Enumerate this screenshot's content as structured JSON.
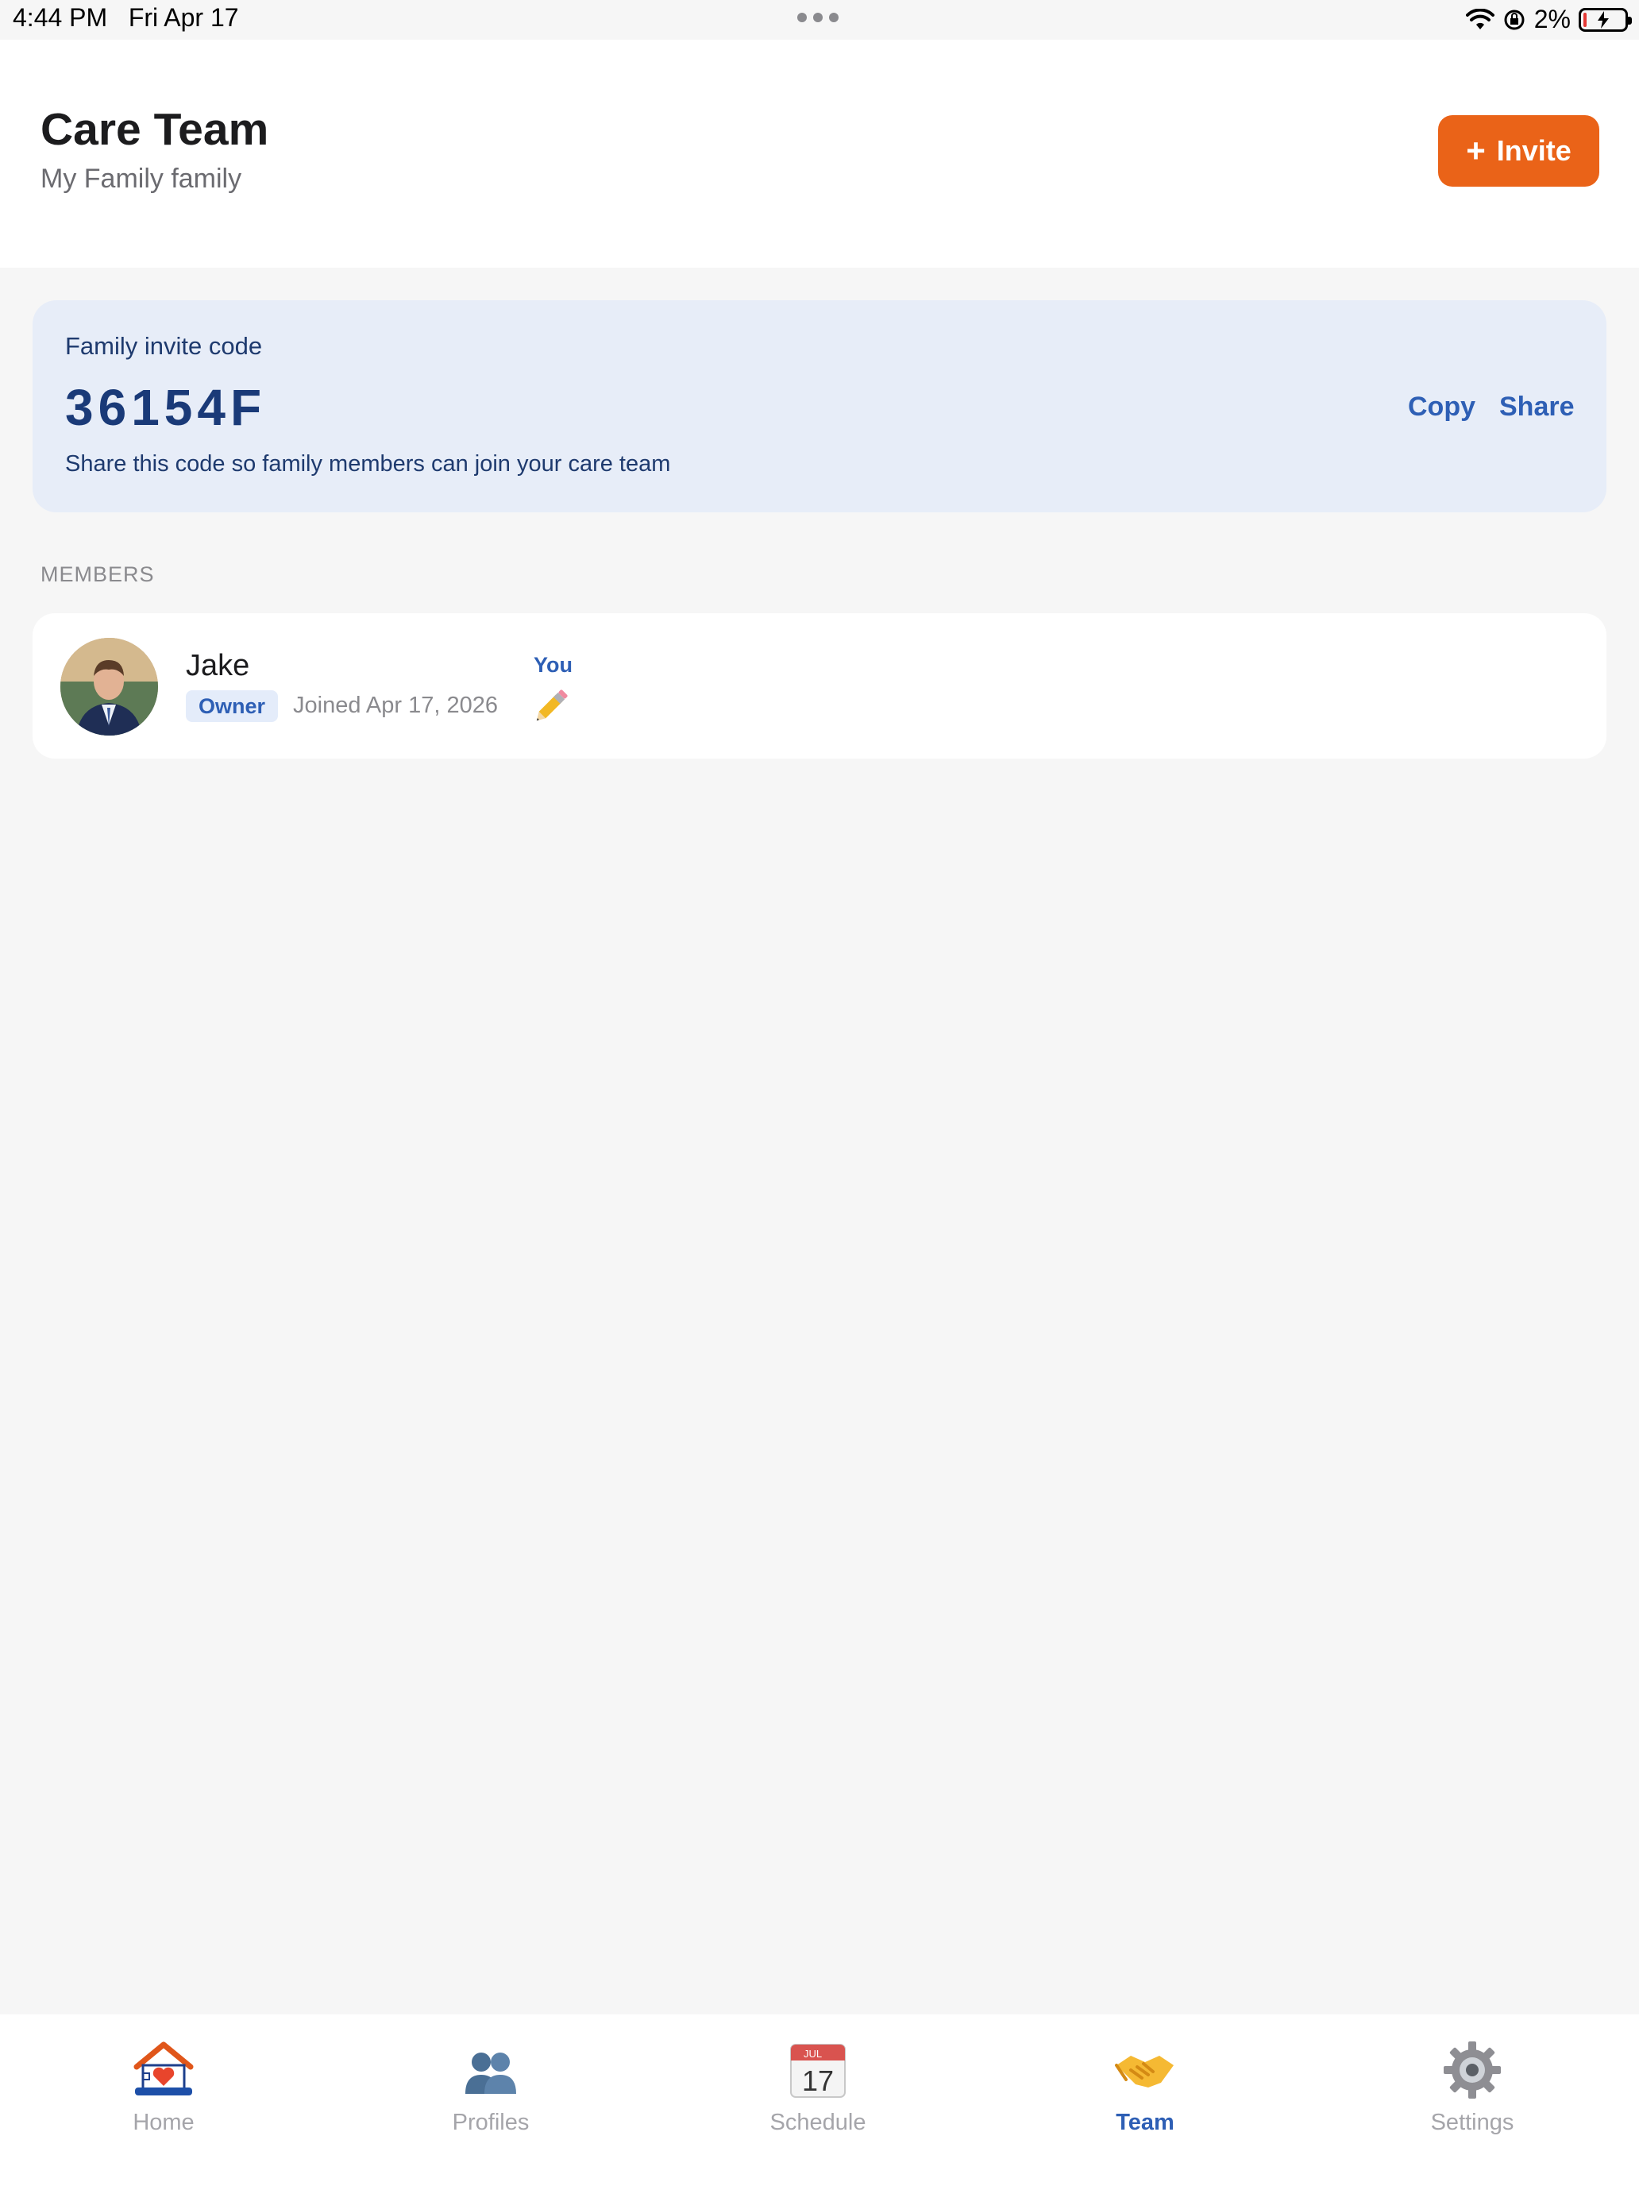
{
  "status_bar": {
    "time": "4:44 PM",
    "date": "Fri Apr 17",
    "battery": "2%"
  },
  "header": {
    "title": "Care Team",
    "subtitle": "My Family family",
    "invite_label": "Invite"
  },
  "invite_card": {
    "label": "Family invite code",
    "code": "36154F",
    "hint": "Share this code so family members can join your care team",
    "copy_label": "Copy",
    "share_label": "Share"
  },
  "members": {
    "heading": "MEMBERS",
    "items": [
      {
        "name": "Jake",
        "role": "Owner",
        "joined": "Joined Apr 17, 2026",
        "you_label": "You"
      }
    ]
  },
  "tabs": [
    {
      "label": "Home",
      "icon": "home-icon"
    },
    {
      "label": "Profiles",
      "icon": "profiles-icon"
    },
    {
      "label": "Schedule",
      "icon": "calendar-icon",
      "calendar_month": "JUL",
      "calendar_day": "17"
    },
    {
      "label": "Team",
      "icon": "handshake-icon",
      "active": true
    },
    {
      "label": "Settings",
      "icon": "gear-icon"
    }
  ],
  "colors": {
    "accent": "#ea6318",
    "link": "#2e5fb5",
    "card_bg": "#e7edf8",
    "page_bg": "#f6f6f6"
  }
}
